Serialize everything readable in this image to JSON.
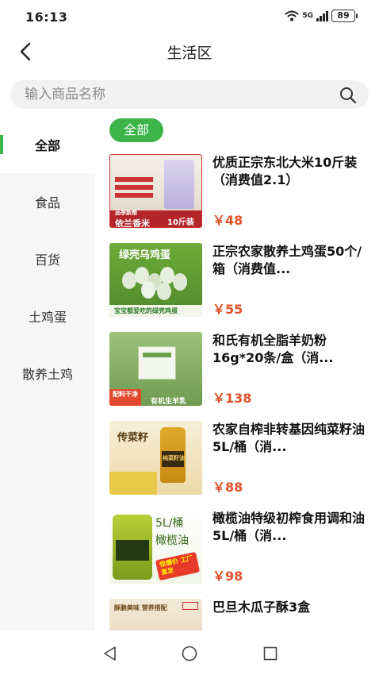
{
  "status_bar": {
    "time": "16:13",
    "network": "5G",
    "battery": "89"
  },
  "nav": {
    "title": "生活区"
  },
  "search": {
    "placeholder": "输入商品名称"
  },
  "sidebar": {
    "items": [
      {
        "label": "全部",
        "active": true
      },
      {
        "label": "食品",
        "active": false
      },
      {
        "label": "百货",
        "active": false
      },
      {
        "label": "土鸡蛋",
        "active": false
      },
      {
        "label": "散养土鸡",
        "active": false
      }
    ]
  },
  "main": {
    "category_chip": "全部",
    "products": [
      {
        "title": "优质正宗东北大米10斤装（消费值2.1）",
        "price": "￥48",
        "image_text_1": "依兰香米",
        "image_text_2": "10斤装",
        "image_text_3": "品季新粮"
      },
      {
        "title": "正宗农家散养土鸡蛋50个/箱（消费值...",
        "price": "￥55",
        "image_text_1": "绿壳乌鸡蛋",
        "image_text_2": "宝宝都爱吃的绿壳鸡蛋"
      },
      {
        "title": "和氏有机全脂羊奶粉16g*20条/盒（消...",
        "price": "￥138",
        "image_text_1": "配料干净",
        "image_text_2": "有机生羊乳"
      },
      {
        "title": "农家自榨非转基因纯菜籽油5L/桶（消...",
        "price": "￥88",
        "image_text_1": "传菜籽",
        "image_text_2": "纯菜籽油"
      },
      {
        "title": "橄榄油特级初榨食用调和油5L/桶（消...",
        "price": "￥98",
        "image_text_1": "5L/桶",
        "image_text_2": "橄榄油",
        "image_text_3": "惊爆价 工厂直发"
      },
      {
        "title": "巴旦木瓜子酥3盒",
        "price": "",
        "image_text_1": "酥脆美味 营养搭配"
      }
    ]
  },
  "colors": {
    "accent": "#3cb44a",
    "price": "#e0502a"
  }
}
